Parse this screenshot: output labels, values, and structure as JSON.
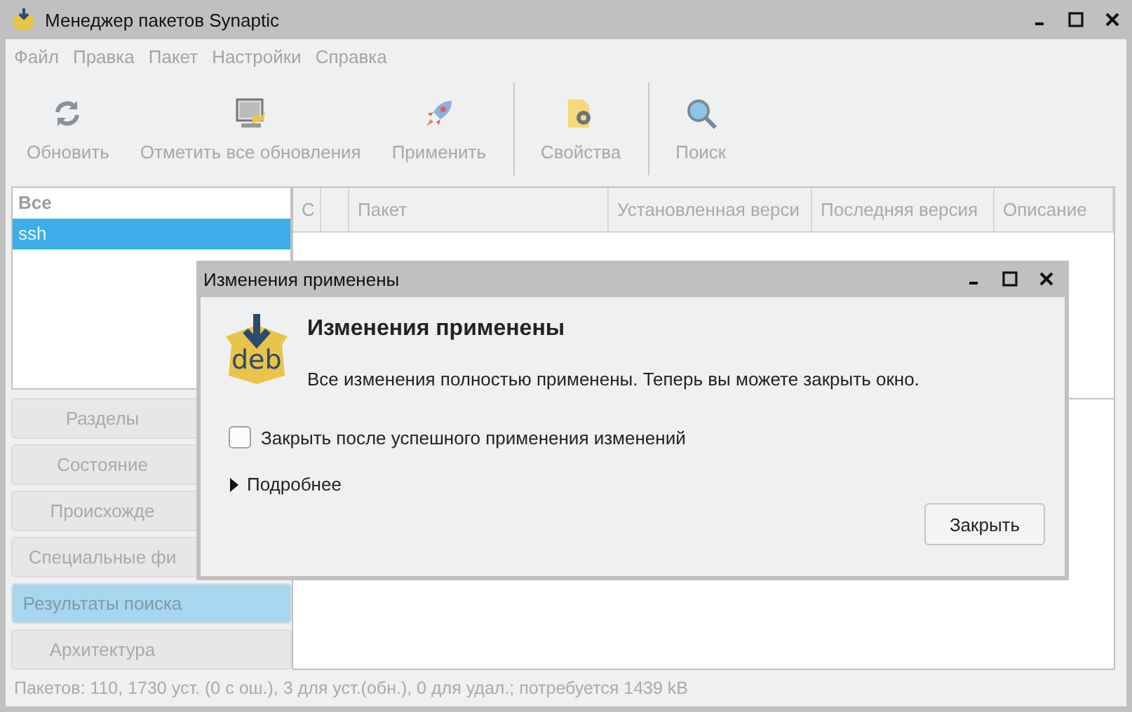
{
  "window": {
    "title": "Менеджер пакетов Synaptic"
  },
  "menu": [
    {
      "label": "Файл",
      "disabled": true
    },
    {
      "label": "Правка",
      "disabled": true
    },
    {
      "label": "Пакет",
      "disabled": true
    },
    {
      "label": "Настройки",
      "disabled": true
    },
    {
      "label": "Справка",
      "disabled": true
    }
  ],
  "toolbar": [
    {
      "kind": "refresh",
      "label": "Обновить",
      "disabled": true
    },
    {
      "kind": "mark",
      "label": "Отметить все обновления",
      "disabled": true
    },
    {
      "kind": "apply",
      "label": "Применить",
      "disabled": true
    },
    {
      "kind": "properties",
      "label": "Свойства",
      "disabled": true
    },
    {
      "kind": "search",
      "label": "Поиск",
      "disabled": true
    }
  ],
  "filter_list": [
    {
      "label": "Все",
      "selected": false
    },
    {
      "label": "ssh",
      "selected": true
    }
  ],
  "sidebar_buttons": [
    {
      "label": "Разделы",
      "selected": false
    },
    {
      "label": "Состояние",
      "selected": false
    },
    {
      "label": "Происхожде",
      "selected": false
    },
    {
      "label": "Специальные фи",
      "selected": false
    },
    {
      "label": "Результаты поиска",
      "selected": true
    },
    {
      "label": "Архитектура",
      "selected": false
    }
  ],
  "table": {
    "columns": [
      "С",
      "",
      "Пакет",
      "Установленная верси",
      "Последняя версия",
      "Описание"
    ]
  },
  "status_bar": "Пакетов: 110, 1730 уст. (0 с ош.), 3 для уст.(обн.), 0 для удал.; потребуется 1439 kB",
  "dialog": {
    "title": "Изменения применены",
    "icon_label": "deb",
    "heading": "Изменения применены",
    "message": "Все изменения полностью применены. Теперь вы можете закрыть окно.",
    "checkbox": {
      "label": "Закрыть после успешного применения изменений",
      "checked": false
    },
    "expander": {
      "label": "Подробнее",
      "expanded": false
    },
    "buttons": [
      "Закрыть"
    ]
  }
}
